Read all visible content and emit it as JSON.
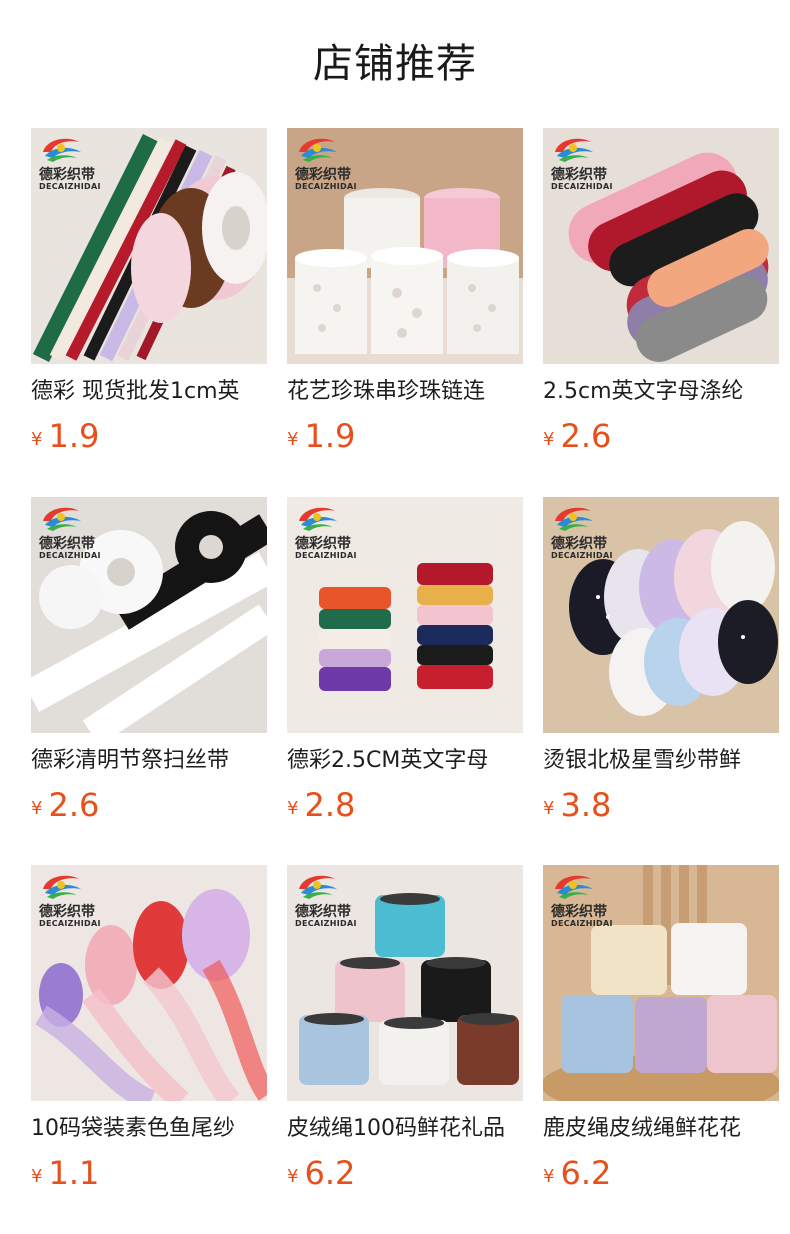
{
  "page": {
    "title": "店铺推荐"
  },
  "brand": {
    "name_cn": "德彩织带",
    "name_en": "DECAIZHIDAI"
  },
  "products": [
    {
      "name": "德彩 现货批发1cm英",
      "currency": "¥",
      "price": "1.9",
      "image": "ribbon-rolls-multicolor"
    },
    {
      "name": "花艺珍珠串珍珠链连",
      "currency": "¥",
      "price": "1.9",
      "image": "pearl-string-spools"
    },
    {
      "name": "2.5cm英文字母涤纶",
      "currency": "¥",
      "price": "2.6",
      "image": "best-wishes-ribbons"
    },
    {
      "name": "德彩清明节祭扫丝带",
      "currency": "¥",
      "price": "2.6",
      "image": "black-white-ribbons"
    },
    {
      "name": "德彩2.5CM英文字母",
      "currency": "¥",
      "price": "2.8",
      "image": "sweetlove-ribbon-stack"
    },
    {
      "name": "烫银北极星雪纱带鲜",
      "currency": "¥",
      "price": "3.8",
      "image": "star-organza-ribbons"
    },
    {
      "name": "10码袋装素色鱼尾纱",
      "currency": "¥",
      "price": "1.1",
      "image": "fishtail-organza"
    },
    {
      "name": "皮绒绳100码鲜花礼品",
      "currency": "¥",
      "price": "6.2",
      "image": "suede-cord-spools"
    },
    {
      "name": "鹿皮绳皮绒绳鲜花花",
      "currency": "¥",
      "price": "6.2",
      "image": "suede-cord-spools-pastel"
    }
  ],
  "colors": {
    "price": "#e5501b",
    "title": "#1a1a1a"
  }
}
